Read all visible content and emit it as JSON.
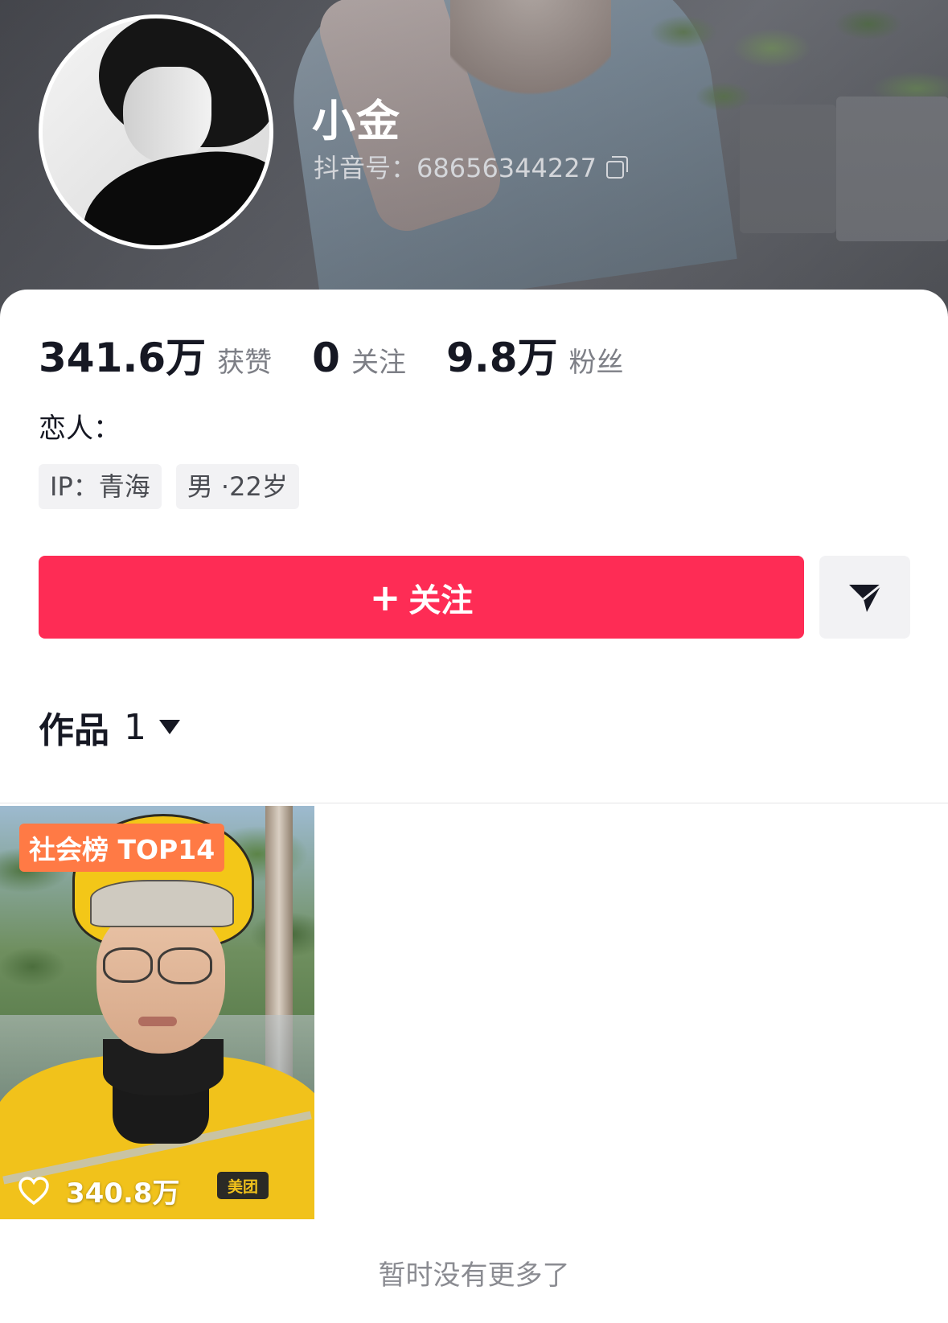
{
  "profile": {
    "username": "小金",
    "douyin_id": "抖音号：68656344227"
  },
  "stats": [
    {
      "value": "341.6万",
      "label": "获赞"
    },
    {
      "value": "0",
      "label": "关注"
    },
    {
      "value": "9.8万",
      "label": "粉丝"
    }
  ],
  "bio": "恋人：",
  "tags": [
    "IP：青海",
    "男 ·22岁"
  ],
  "actions": {
    "follow_label": "关注",
    "share_icon": "send-icon"
  },
  "works": {
    "label": "作品",
    "count": "1"
  },
  "video": {
    "rank_badge": "社会榜 TOP14",
    "likes": "340.8万",
    "logo_text": "美团"
  },
  "footer": {
    "no_more": "暂时没有更多了"
  },
  "colors": {
    "accent": "#fe2c55",
    "badge": "#ff7a45"
  }
}
